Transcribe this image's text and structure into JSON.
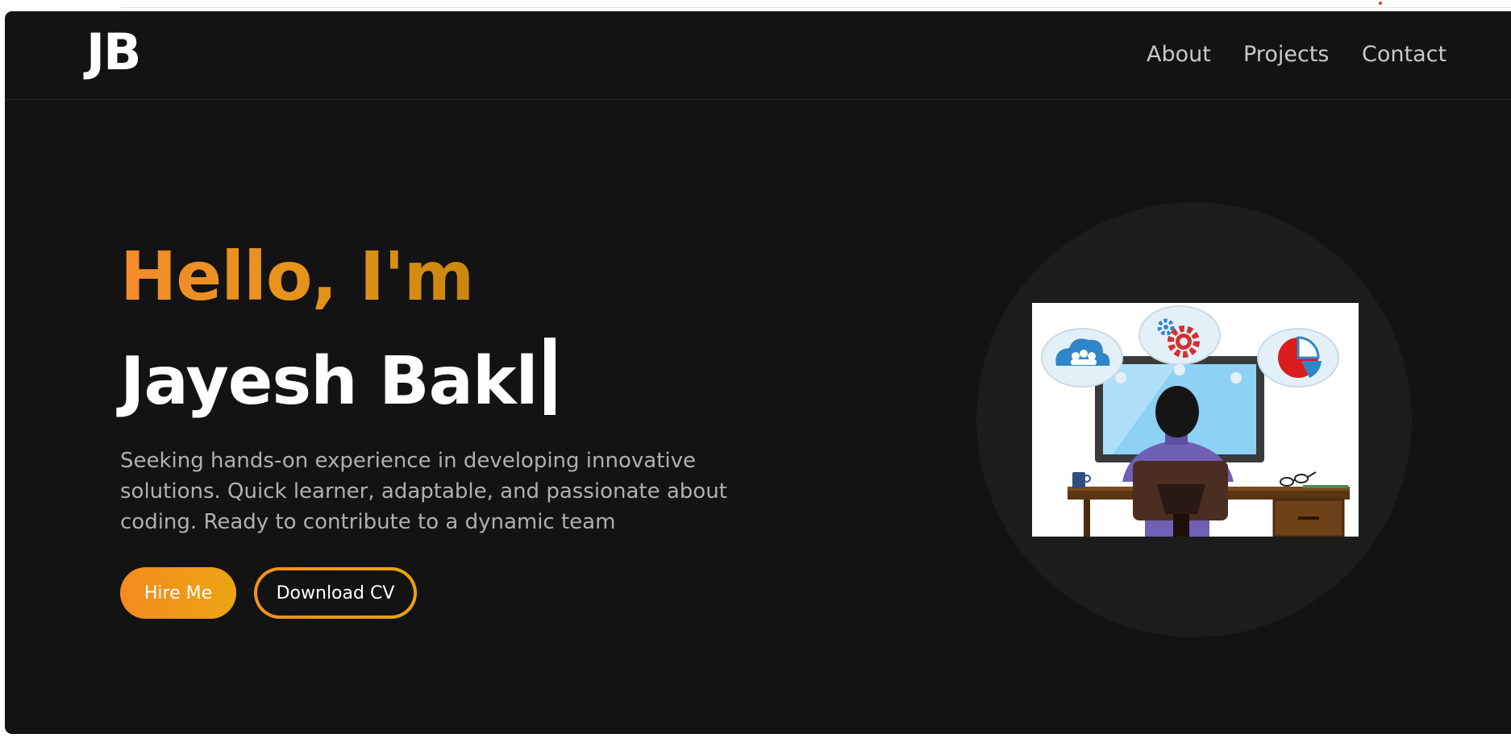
{
  "nav": {
    "logo": "JB",
    "links": [
      "About",
      "Projects",
      "Contact"
    ]
  },
  "hero": {
    "greeting": "Hello, I'm",
    "name": "Jayesh Bakl",
    "tagline": "Seeking hands-on experience in developing innovative solutions. Quick learner, adaptable, and passionate about coding. Ready to contribute to a dynamic team",
    "buttons": {
      "hire": "Hire Me",
      "download_cv": "Download CV"
    }
  },
  "colors": {
    "background": "#131313",
    "accent_start": "#f58b2b",
    "accent_end": "#e9a20f",
    "text_muted": "#b0b0b0"
  },
  "illustration": {
    "description_icons": [
      "cloud-users-icon",
      "gears-icon",
      "pie-chart-icon",
      "developer-at-desk-illustration"
    ]
  }
}
